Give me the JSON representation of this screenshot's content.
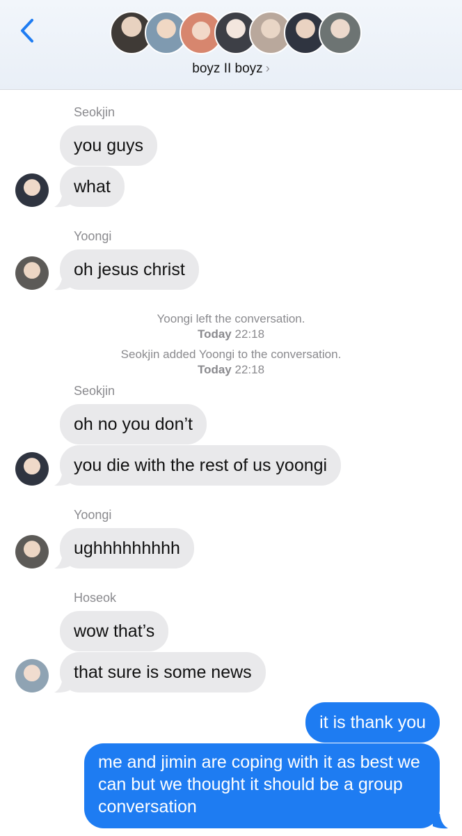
{
  "header": {
    "group_name": "boyz II boyz",
    "chevron": "›",
    "avatar_colors": [
      "#3f3a36",
      "#7f9ab0",
      "#d7866e",
      "#3d3f46",
      "#b9a89c",
      "#2f3440",
      "#6d7473"
    ]
  },
  "messages": [
    {
      "sender": "Seokjin",
      "bubbles": [
        "you guys",
        "what"
      ]
    },
    {
      "sender": "Yoongi",
      "bubbles": [
        "oh jesus christ"
      ]
    },
    {
      "sender": "Seokjin",
      "bubbles": [
        "oh no you don’t",
        "you die with the rest of us yoongi"
      ]
    },
    {
      "sender": "Yoongi",
      "bubbles": [
        "ughhhhhhhhh"
      ]
    },
    {
      "sender": "Hoseok",
      "bubbles": [
        "wow that’s",
        "that sure is some news"
      ]
    }
  ],
  "system": [
    {
      "text": "Yoongi left the conversation.",
      "day": "Today",
      "time": "22:18"
    },
    {
      "text": "Seokjin added Yoongi to the conversation.",
      "day": "Today",
      "time": "22:18"
    }
  ],
  "outgoing": [
    "it is thank you",
    "me and jimin are coping with it as best we can but we thought it should be a group conversation"
  ],
  "colors": {
    "accent": "#1e7cf2",
    "incoming_bubble": "#e9e9eb",
    "meta_text": "#8a8a8e"
  }
}
